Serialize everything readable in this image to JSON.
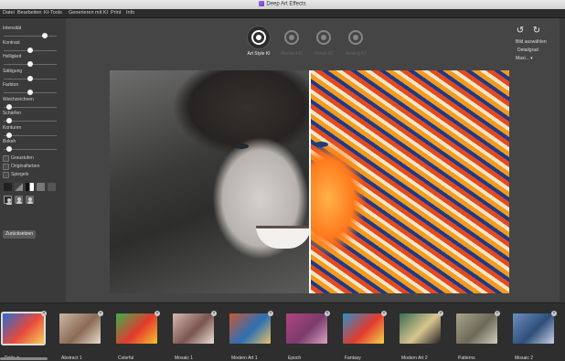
{
  "window": {
    "title": "Deep Art Effects"
  },
  "menu": [
    "Datei",
    "Bearbeiten",
    "KI-Tools",
    "Generieren mit KI",
    "Print",
    "Info"
  ],
  "sidebar": {
    "sliders": [
      {
        "label": "Intensität",
        "value": 0.8
      },
      {
        "label": "Kontrast",
        "value": 0.5
      },
      {
        "label": "Helligkeit",
        "value": 0.5
      },
      {
        "label": "Sättigung",
        "value": 0.5
      },
      {
        "label": "Farbton",
        "value": 0.5
      },
      {
        "label": "Weichzeichnen",
        "value": 0.05
      },
      {
        "label": "Schärfen",
        "value": 0.05
      },
      {
        "label": "Konturen",
        "value": 0.05
      },
      {
        "label": "Bokeh",
        "value": 0.05
      }
    ],
    "checkboxes": [
      "Graustufen",
      "Originalfarben",
      "Spiegeln"
    ],
    "reset_label": "Zurücksetzen"
  },
  "modes": [
    {
      "label": "Art Style KI",
      "icon": "art-style-icon",
      "active": true
    },
    {
      "label": "Abstract KI",
      "icon": "abstract-icon",
      "active": false
    },
    {
      "label": "Vision KI",
      "icon": "vision-icon",
      "active": false
    },
    {
      "label": "Analog KI",
      "icon": "analog-icon",
      "active": false
    }
  ],
  "right_panel": {
    "undo_icon": "undo-icon",
    "redo_icon": "redo-icon",
    "choose_image": "Bild auswählen",
    "detail": "Detailgrad",
    "size": "Maxi..."
  },
  "styles": [
    {
      "label": "Daily ★",
      "selected": true,
      "colors": [
        "#2a6bd1",
        "#e84a3c",
        "#f5d05a"
      ]
    },
    {
      "label": "Abstract 1",
      "selected": false,
      "colors": [
        "#c9b8a6",
        "#8a6a55",
        "#e7dccf"
      ]
    },
    {
      "label": "Colorful",
      "selected": false,
      "colors": [
        "#3fae4b",
        "#e33a2f",
        "#f6c12c"
      ]
    },
    {
      "label": "Mosaic 1",
      "selected": false,
      "colors": [
        "#d7b8b2",
        "#7a5550",
        "#f0e2d8"
      ]
    },
    {
      "label": "Modern Art 1",
      "selected": false,
      "colors": [
        "#c75a3a",
        "#2c6fb3",
        "#e9c26a"
      ]
    },
    {
      "label": "Epoch",
      "selected": false,
      "colors": [
        "#b0447e",
        "#7b3b6b",
        "#d9a3c2"
      ]
    },
    {
      "label": "Fantasy",
      "selected": false,
      "colors": [
        "#2c8fc9",
        "#e23b2d",
        "#f7d24b"
      ]
    },
    {
      "label": "Modern Art 2",
      "selected": false,
      "colors": [
        "#3a6d50",
        "#d8c58f",
        "#232323"
      ]
    },
    {
      "label": "Patterns",
      "selected": false,
      "colors": [
        "#a9a38d",
        "#6c6958",
        "#d3cfbd"
      ]
    },
    {
      "label": "Mosaic 2",
      "selected": false,
      "colors": [
        "#6c8fbf",
        "#2f4e7a",
        "#c8d4e6"
      ]
    }
  ]
}
